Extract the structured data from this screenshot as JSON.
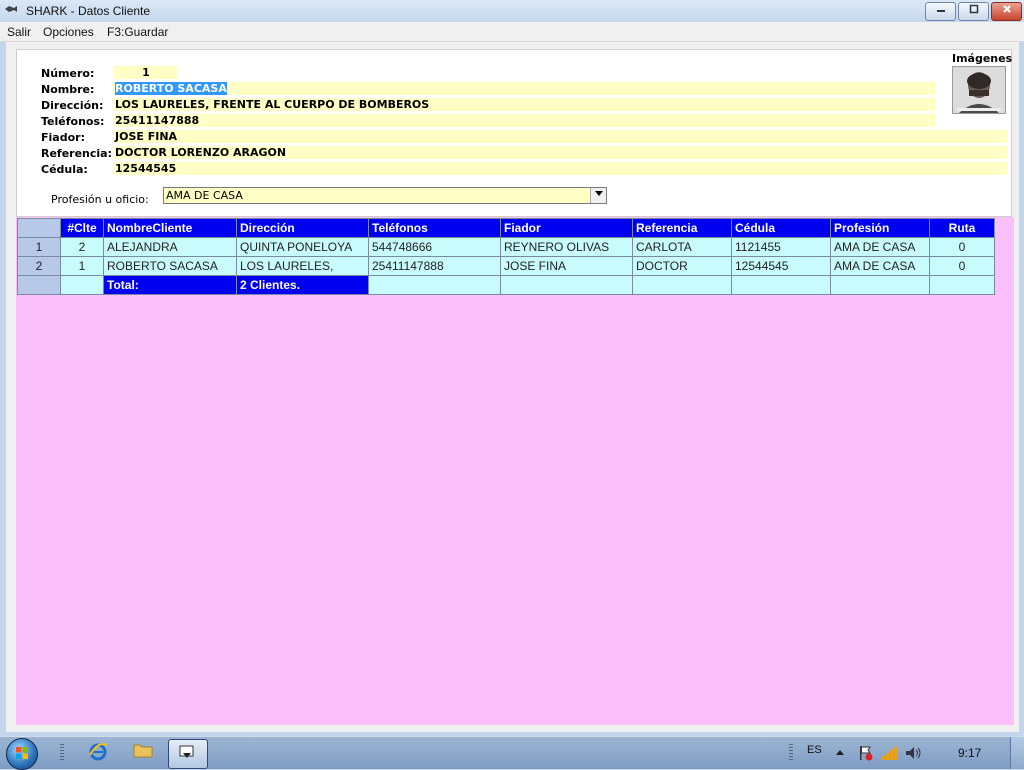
{
  "window": {
    "title": "SHARK - Datos Cliente",
    "icon": "fish-icon",
    "controls": {
      "minimize": "minimize-icon",
      "maximize": "maximize-icon",
      "close": "close-icon"
    }
  },
  "menu": {
    "items": [
      "Salir",
      "Opciones",
      "F3:Guardar"
    ]
  },
  "form": {
    "numero": {
      "label": "Número:",
      "value": "1"
    },
    "nombre": {
      "label": "Nombre:",
      "value": "ROBERTO SACASA"
    },
    "direccion": {
      "label": "Dirección:",
      "value": "LOS LAURELES, FRENTE AL CUERPO DE BOMBEROS"
    },
    "telefonos": {
      "label": "Teléfonos:",
      "value": "25411147888"
    },
    "fiador": {
      "label": "Fiador:",
      "value": "JOSE FINA"
    },
    "referencia": {
      "label": "Referencia:",
      "value": "DOCTOR LORENZO ARAGON"
    },
    "cedula": {
      "label": "Cédula:",
      "value": "12544545"
    },
    "profesion": {
      "label": "Profesión u oficio:",
      "value": "AMA DE CASA"
    },
    "imagenes_label": "Imágenes"
  },
  "grid": {
    "columns": [
      "#Clte",
      "NombreCliente",
      "Dirección",
      "Teléfonos",
      "Fiador",
      "Referencia",
      "Cédula",
      "Profesión",
      "Ruta"
    ],
    "rows": [
      {
        "row": "1",
        "clte": "2",
        "nombre": "ALEJANDRA",
        "direccion": "QUINTA PONELOYA",
        "telefonos": "544748666",
        "fiador": "REYNERO OLIVAS",
        "referencia": "CARLOTA",
        "cedula": "1121455",
        "profesion": "AMA DE CASA",
        "ruta": "0"
      },
      {
        "row": "2",
        "clte": "1",
        "nombre": "ROBERTO SACASA",
        "direccion": "LOS LAURELES,",
        "telefonos": "25411147888",
        "fiador": "JOSE FINA",
        "referencia": "DOCTOR",
        "cedula": "12544545",
        "profesion": "AMA DE CASA",
        "ruta": "0"
      }
    ],
    "total": {
      "label": "Total:",
      "value": "2 Clientes."
    }
  },
  "taskbar": {
    "language": "ES",
    "clock": "9:17"
  },
  "colors": {
    "field_bg": "#ffffc6",
    "grid_header": "#0000f0",
    "grid_cell": "#c8fbfb",
    "grid_area": "#fbc0fb",
    "selection": "#3399ff"
  }
}
